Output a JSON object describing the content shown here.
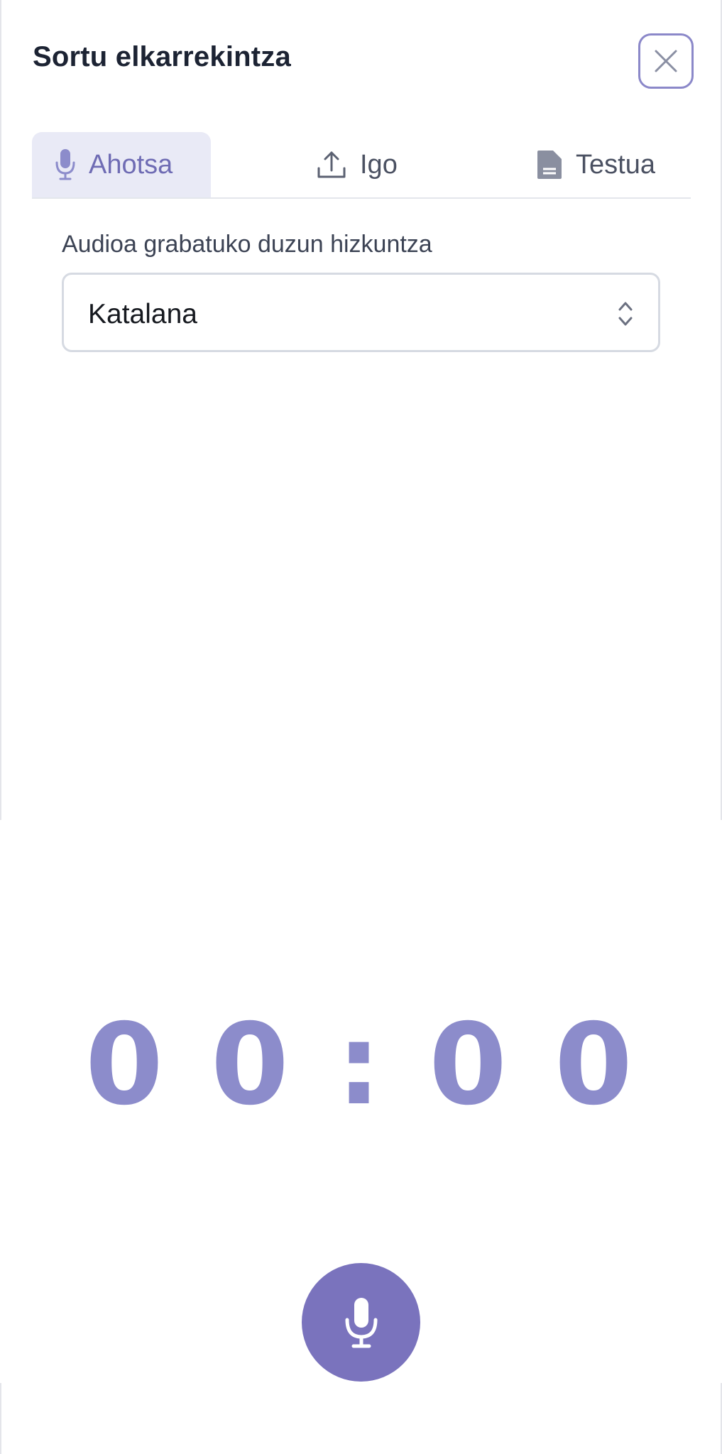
{
  "header": {
    "title": "Sortu elkarrekintza",
    "close_icon": "close-icon"
  },
  "tabs": [
    {
      "label": "Ahotsa",
      "icon": "microphone-icon",
      "selected": true
    },
    {
      "label": "Igo",
      "icon": "upload-icon",
      "selected": false
    },
    {
      "label": "Testua",
      "icon": "document-icon",
      "selected": false
    }
  ],
  "language": {
    "label": "Audioa grabatuko duzun hizkuntza",
    "selected": "Katalana"
  },
  "timer": {
    "minutes": "0 0",
    "separator": ":",
    "seconds": "0 0"
  },
  "record": {
    "icon": "microphone-icon"
  },
  "colors": {
    "accent": "#7a73bd",
    "timer": "#8c8ccb",
    "tab_active_bg": "#e9eaf6"
  }
}
